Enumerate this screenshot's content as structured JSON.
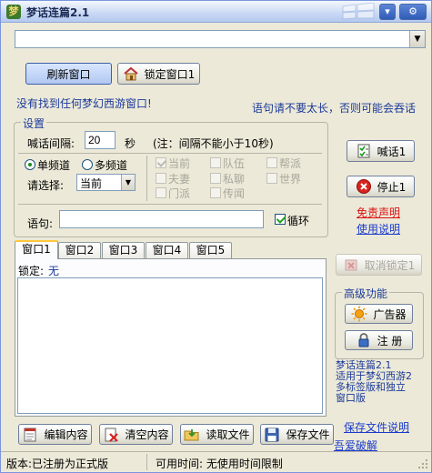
{
  "window": {
    "title": "梦话连篇2.1",
    "minimize_glyph": "▾",
    "close_glyph": "⚙"
  },
  "top_combo": {
    "value": ""
  },
  "buttons": {
    "refresh": "刷新窗口",
    "lock": "锁定窗口1",
    "shout": "喊话1",
    "stop": "停止1",
    "unlock": "取消锁定1",
    "ads": "广告器",
    "register": "注  册",
    "edit": "编辑内容",
    "clear": "清空内容",
    "read": "读取文件",
    "save": "保存文件"
  },
  "messages": {
    "not_found": "没有找到任何梦幻西游窗口!",
    "warning": "语句请不要太长，否则可能会吞话"
  },
  "settings": {
    "group_label": "设置",
    "interval_label": "喊话间隔:",
    "interval_value": "20",
    "interval_unit": "秒",
    "interval_note": "(注：间隔不能小于10秒)",
    "single_channel": "单频道",
    "multi_channel": "多频道",
    "choose_label": "请选择:",
    "choose_value": "当前",
    "channels": [
      "当前",
      "队伍",
      "帮派",
      "夫妻",
      "私聊",
      "世界",
      "门派",
      "传闻"
    ],
    "sentence_label": "语句:",
    "sentence_value": "",
    "loop_label": "循环"
  },
  "links": {
    "disclaimer": "免责声明",
    "usage": "使用说明",
    "save_help": "保存文件说明",
    "crack": "吾爱破解"
  },
  "tabs": [
    "窗口1",
    "窗口2",
    "窗口3",
    "窗口4",
    "窗口5"
  ],
  "lock_status": {
    "label": "锁定:",
    "value": "无"
  },
  "advanced": {
    "group_label": "高级功能",
    "about": "梦话连篇2.1\n适用于梦幻西游2\n多标签版和独立\n窗口版"
  },
  "status_bar": {
    "version": "版本:已注册为正式版",
    "time": "可用时间: 无使用时间限制"
  },
  "colors": {
    "accent": "#ffc83c",
    "link": "#1a3bcc",
    "warning_link": "#d11111"
  }
}
